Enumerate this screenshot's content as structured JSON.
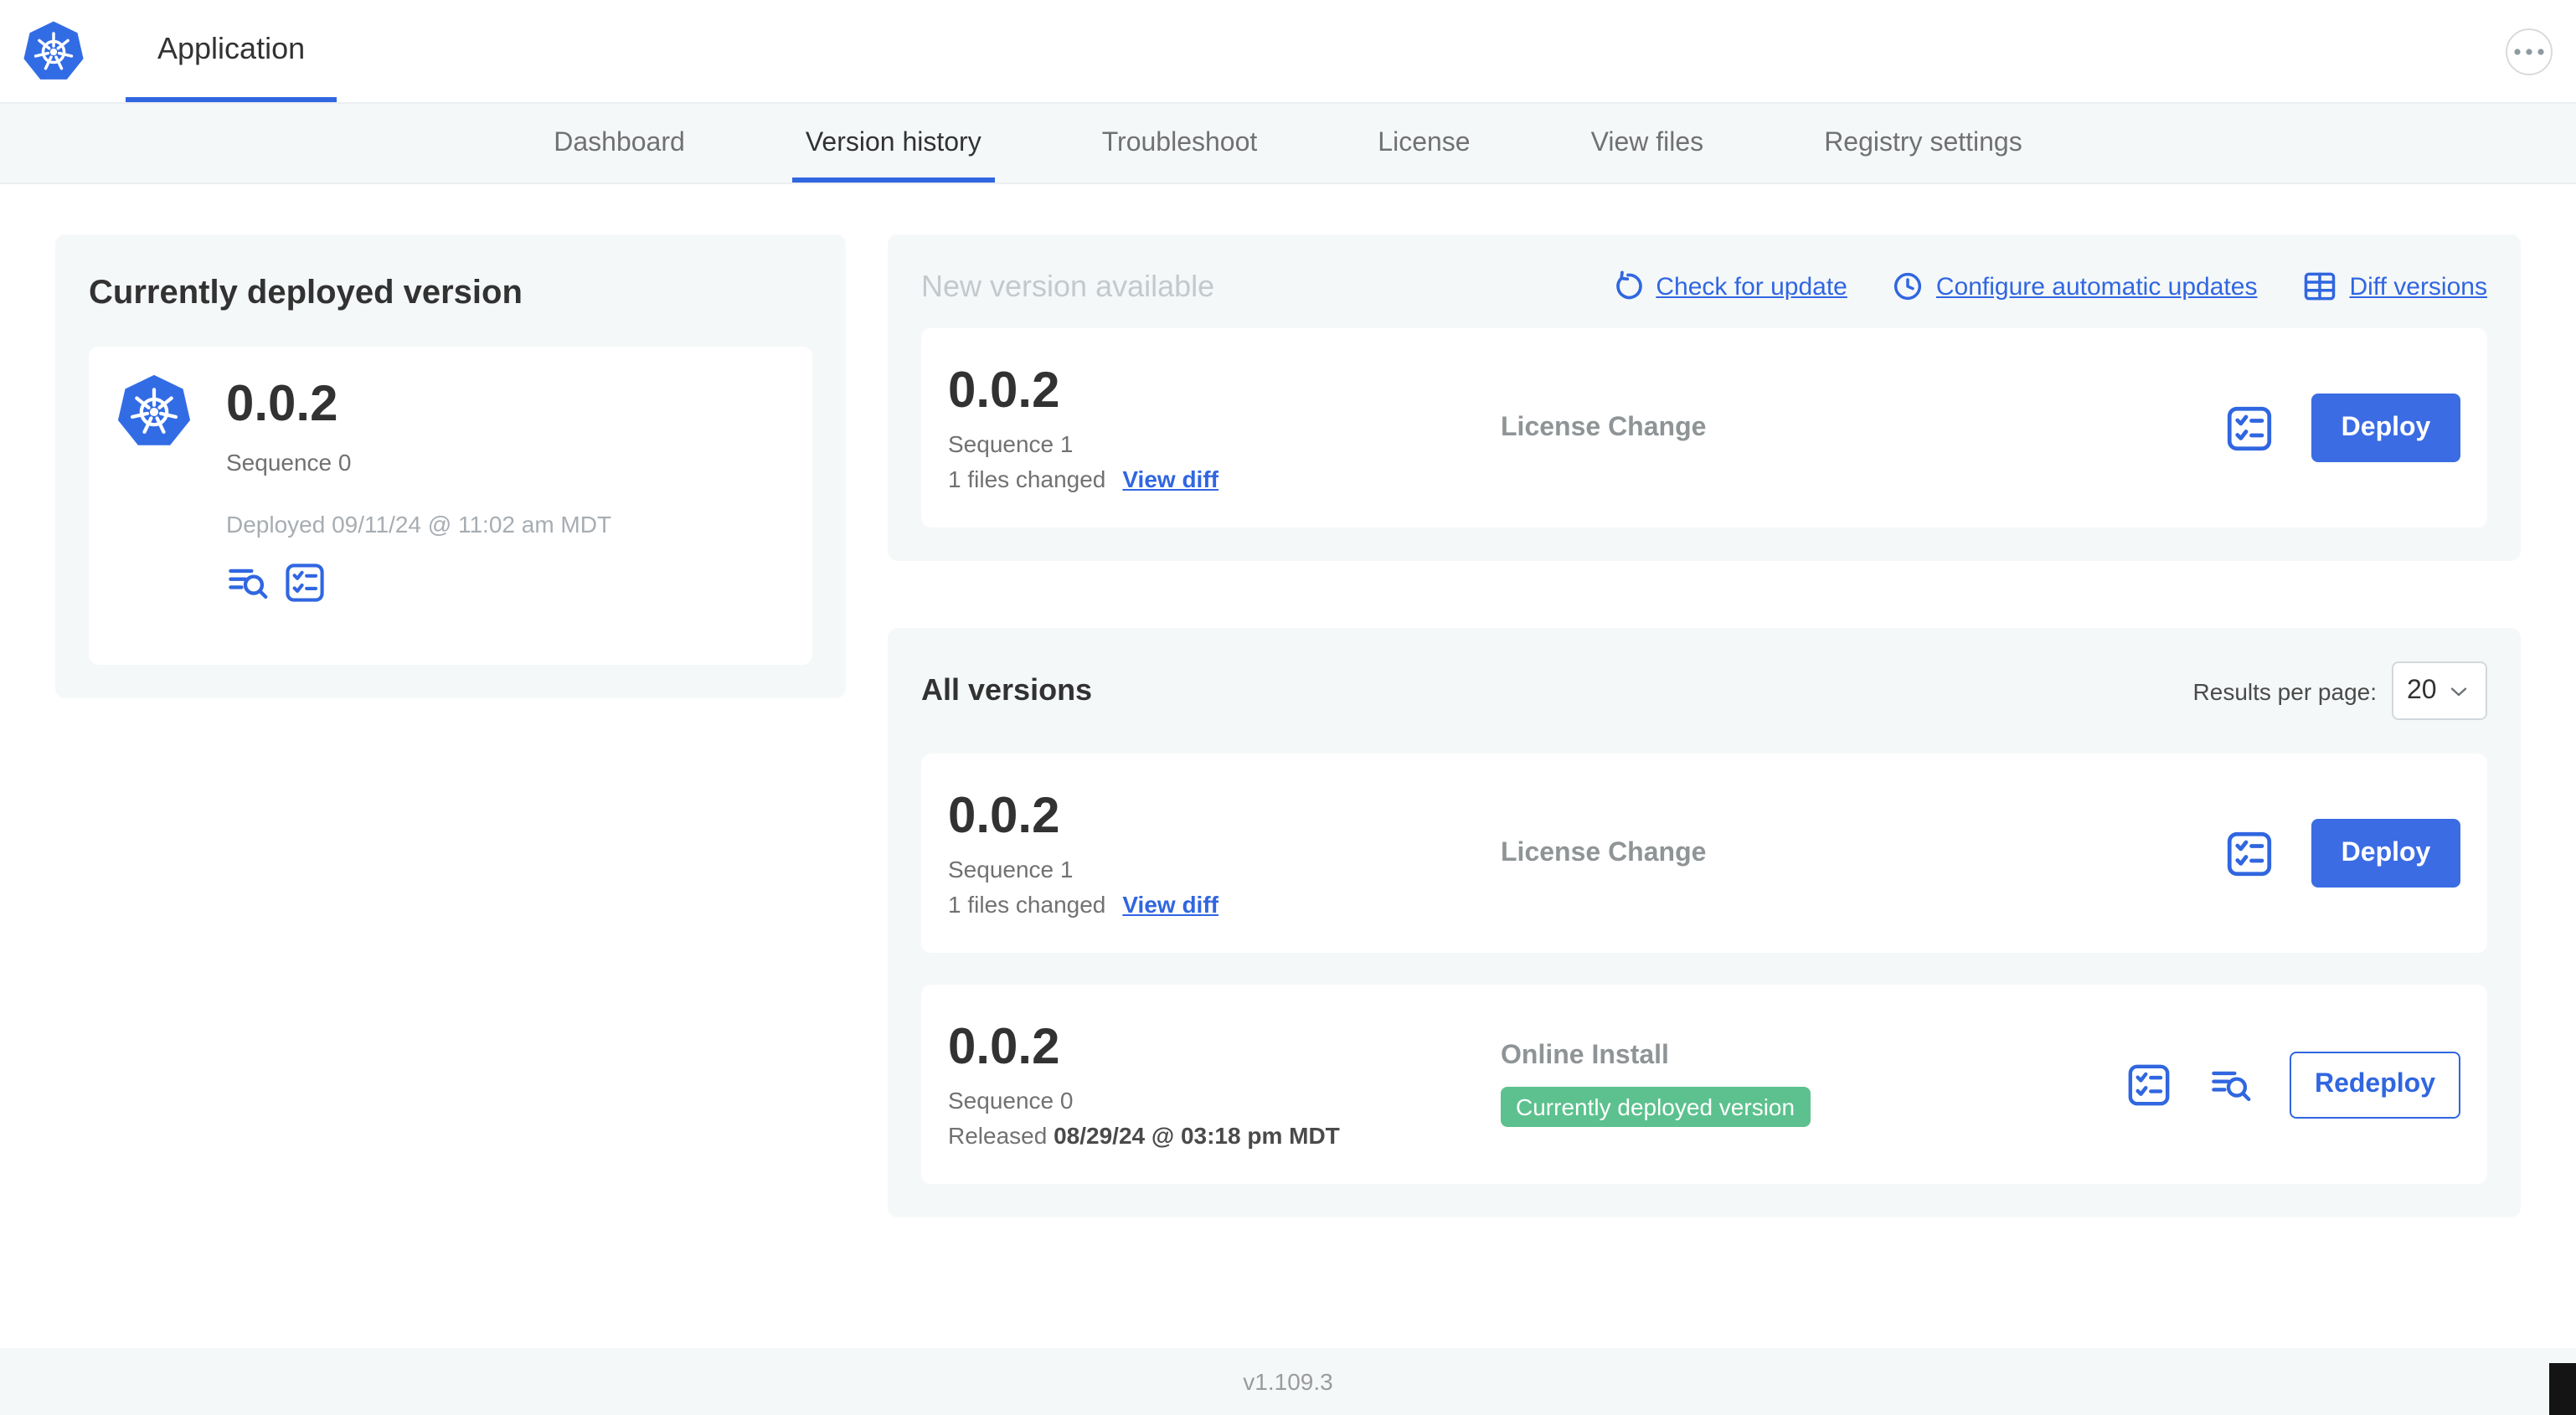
{
  "colors": {
    "accent_blue": "#3066e0",
    "deploy_button_blue": "#3b6ce4",
    "badge_green": "#5cc18e",
    "panel_gray": "#f5f8f9"
  },
  "icons": {
    "kubernetes-logo": "blue heptagon with white helm wheel",
    "more": "ellipsis in circle",
    "check-for-update": "counterclockwise refresh arrow",
    "configure-automatic-updates": "clock",
    "diff-versions": "two-column table",
    "preflight-checks": "bordered checklist",
    "logs": "text lines with magnifier",
    "select": "chevron-down"
  },
  "header": {
    "app_tab_label": "Application"
  },
  "subnav": {
    "tabs": [
      {
        "label": "Dashboard"
      },
      {
        "label": "Version history"
      },
      {
        "label": "Troubleshoot"
      },
      {
        "label": "License"
      },
      {
        "label": "View files"
      },
      {
        "label": "Registry settings"
      }
    ]
  },
  "current_version": {
    "title": "Currently deployed version",
    "version": "0.0.2",
    "sequence": "Sequence 0",
    "deployed": "Deployed 09/11/24 @ 11:02 am MDT"
  },
  "new_version": {
    "title": "New version available",
    "check_for_update_label": "Check for update",
    "configure_auto_updates_label": "Configure automatic updates",
    "diff_versions_label": "Diff versions",
    "row": {
      "version": "0.0.2",
      "sequence": "Sequence 1",
      "files_changed": "1 files changed",
      "view_diff_label": "View diff",
      "source": "License Change",
      "action_label": "Deploy"
    }
  },
  "all_versions": {
    "title": "All versions",
    "results_per_page_label": "Results per page:",
    "results_per_page_value": "20",
    "rows": [
      {
        "version": "0.0.2",
        "sequence": "Sequence 1",
        "files_changed": "1 files changed",
        "view_diff_label": "View diff",
        "source": "License Change",
        "action_label": "Deploy"
      },
      {
        "version": "0.0.2",
        "sequence": "Sequence 0",
        "released_label": "Released",
        "released_date": "08/29/24 @ 03:18 pm MDT",
        "source": "Online Install",
        "badge": "Currently deployed version",
        "action_label": "Redeploy"
      }
    ]
  },
  "footer": {
    "app_version": "v1.109.3"
  }
}
